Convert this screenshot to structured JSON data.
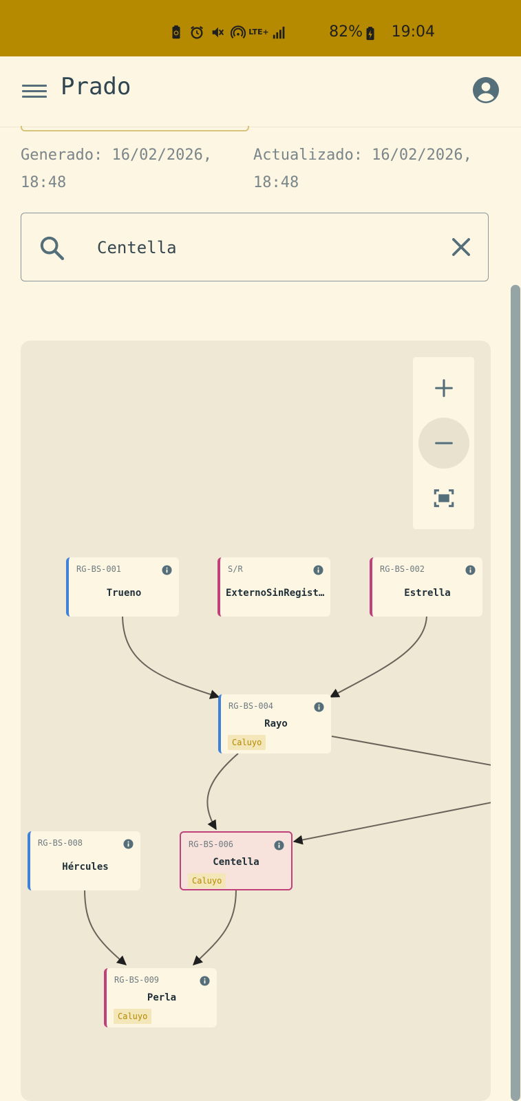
{
  "status_bar": {
    "icons": [
      "battery-saver-icon",
      "alarm-icon",
      "vibrate-icon",
      "hotspot-icon",
      "lte-icon",
      "signal-icon",
      "battery-charging-icon"
    ],
    "lte": "LTE+",
    "battery": "82%",
    "time": "19:04"
  },
  "app_bar": {
    "title": "Prado"
  },
  "meta": {
    "generated": "Generado: 16/02/2026, 18:48",
    "updated": "Actualizado: 16/02/2026, 18:48"
  },
  "search": {
    "value": "Centella"
  },
  "graph": {
    "nodes": [
      {
        "code": "RG-BS-001",
        "name": "Trueno"
      },
      {
        "code": "S/R",
        "name": "ExternoSinRegistr…"
      },
      {
        "code": "RG-BS-002",
        "name": "Estrella"
      },
      {
        "code": "RG-BS-004",
        "name": "Rayo",
        "badge": "Caluyo"
      },
      {
        "code": "RG-BS-008",
        "name": "Hércules"
      },
      {
        "code": "RG-BS-006",
        "name": "Centella",
        "badge": "Caluyo"
      },
      {
        "code": "RG-BS-009",
        "name": "Perla",
        "badge": "Caluyo"
      }
    ],
    "colors": {
      "male": "#3f80d8",
      "female": "#c0407a",
      "badge": "#b58900",
      "edge": "#6b6259"
    }
  }
}
